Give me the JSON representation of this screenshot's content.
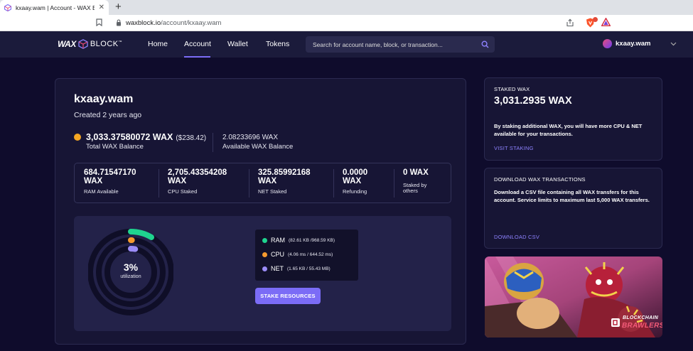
{
  "browser": {
    "tab_title": "kxaay.wam | Account - WAX Explo",
    "tab_close": "✕",
    "new_tab": "+",
    "url_host": "waxblock.io",
    "url_path": "/account/kxaay.wam"
  },
  "nav": {
    "logo_wax": "WAX",
    "logo_block": "BLOCK",
    "logo_tm": "™",
    "links": [
      "Home",
      "Account",
      "Wallet",
      "Tokens"
    ],
    "active": "Account",
    "search_placeholder": "Search for account name, block, or transaction...",
    "user": "kxaay.wam"
  },
  "account": {
    "name": "kxaay.wam",
    "created": "Created 2 years ago",
    "total_balance": "3,033.37580072 WAX",
    "total_usd": "($238.42)",
    "total_label": "Total WAX Balance",
    "available_balance": "2.08233696 WAX",
    "available_label": "Available WAX Balance",
    "stats": [
      {
        "value_line1": "684.71547170",
        "value_line2": "WAX",
        "label_line1": "RAM Available",
        "label_line2": ""
      },
      {
        "value_line1": "2,705.43354208",
        "value_line2": "WAX",
        "label_line1": "CPU Staked",
        "label_line2": ""
      },
      {
        "value_line1": "325.85992168",
        "value_line2": "WAX",
        "label_line1": "NET Staked",
        "label_line2": ""
      },
      {
        "value_line1": "0.0000",
        "value_line2": "WAX",
        "label_line1": "Refunding",
        "label_line2": ""
      },
      {
        "value_line1": "0 WAX",
        "value_line2": "",
        "label_line1": "Staked by",
        "label_line2": "others"
      }
    ]
  },
  "resources": {
    "utilization": "3%",
    "utilization_label": "utilization",
    "ram_fraction": 0.085,
    "cpu_fraction": 0.006,
    "net_fraction": 0.03,
    "legend": [
      {
        "name": "RAM",
        "detail": "(82.61 KB /968.59 KB)",
        "color": "#1fd48f"
      },
      {
        "name": "CPU",
        "detail": "(4.06 ms / 644.52 ms)",
        "color": "#f59a2f"
      },
      {
        "name": "NET",
        "detail": "(1.65 KB / 55.43 MB)",
        "color": "#9b8cf7"
      }
    ],
    "stake_button": "STAKE RESOURCES"
  },
  "staked": {
    "title": "STAKED WAX",
    "value": "3,031.2935 WAX",
    "text": "By staking additional WAX, you will have more CPU & NET available for your transactions.",
    "link": "VISIT STAKING"
  },
  "download": {
    "title": "DOWNLOAD WAX TRANSACTIONS",
    "text": "Download a CSV file containing all WAX transfers for this account. Service limits to maximum last 5,000 WAX transfers.",
    "link": "DOWNLOAD CSV"
  },
  "banner": {
    "line1": "BLOCKCHAIN",
    "line2": "BRAWLERS"
  },
  "colors": {
    "accent": "#7b6cf6",
    "ram": "#1fd48f",
    "cpu": "#f59a2f",
    "net": "#9b8cf7"
  }
}
